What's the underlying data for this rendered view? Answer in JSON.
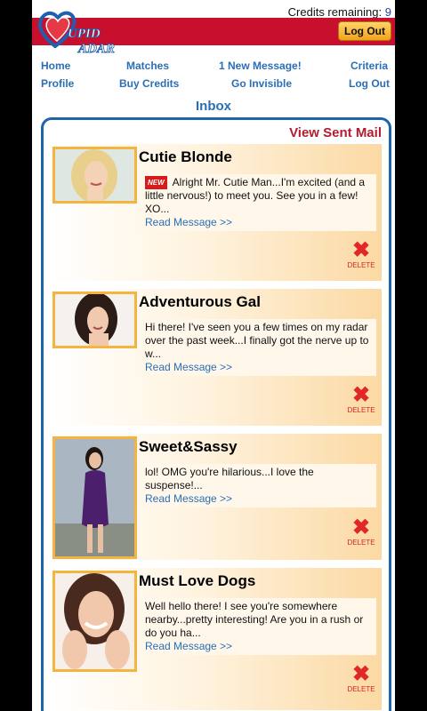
{
  "header": {
    "credits_label": "Credits remaining:",
    "credits_value": "9",
    "logo_text": "Cupid Radar",
    "logout_button": "Log Out"
  },
  "nav": {
    "home": "Home",
    "matches": "Matches",
    "new_message": "1 New Message!",
    "criteria": "Criteria",
    "profile": "Profile",
    "buy_credits": "Buy Credits",
    "go_invisible": "Go Invisible",
    "log_out": "Log Out"
  },
  "inbox": {
    "title": "Inbox",
    "view_sent": "View Sent Mail",
    "read_label": "Read Message >>",
    "delete_label": "DELETE",
    "new_badge": "NEW",
    "messages": [
      {
        "name": "Cutie Blonde",
        "preview": "Alright Mr. Cutie Man...I'm excited (and a little nervous!) to meet you. See you in a few! XO..."
      },
      {
        "name": "Adventurous Gal",
        "preview": "Hi there! I've seen you a few times on my radar over the past week...I finally got the nerve up to w..."
      },
      {
        "name": "Sweet&Sassy",
        "preview": "lol! OMG you're hilarious...I love the suspense!..."
      },
      {
        "name": "Must Love Dogs",
        "preview": "Well hello there! I see you're somewhere nearby...pretty interesting! Are you in a rush or do you ha..."
      }
    ]
  },
  "colors": {
    "banner": "#c8102e",
    "link": "#2a6fb6",
    "panel_border": "#1f63a8",
    "photo_border": "#f3b440"
  }
}
